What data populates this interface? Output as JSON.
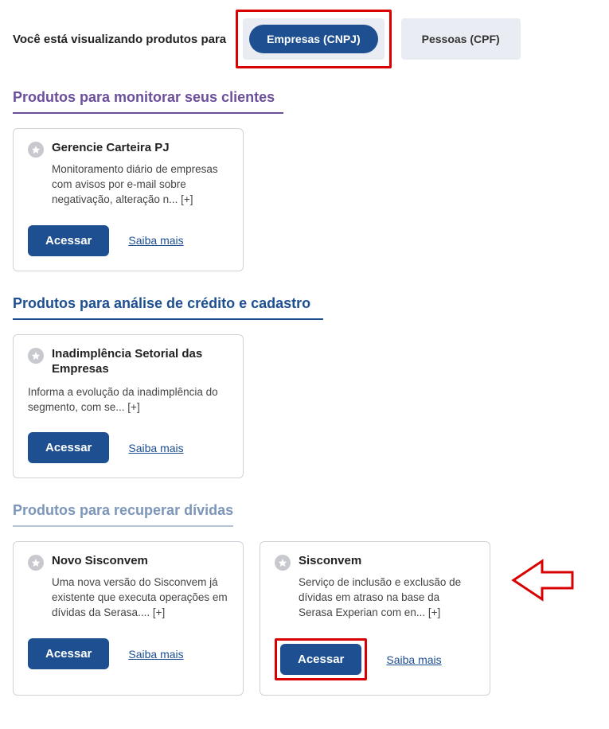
{
  "filter": {
    "label": "Você está visualizando produtos para",
    "option_active": "Empresas (CNPJ)",
    "option_inactive": "Pessoas (CPF)"
  },
  "sections": {
    "monitor": {
      "title": "Produtos para monitorar seus clientes",
      "card": {
        "title": "Gerencie Carteira PJ",
        "desc": "Monitoramento diário de empresas com avisos por e-mail sobre negativação, alteração n... [+]",
        "btn": "Acessar",
        "more": "Saiba mais"
      }
    },
    "credito": {
      "title": "Produtos para análise de crédito e cadastro",
      "card": {
        "title": "Inadimplência Setorial das Empresas",
        "desc": "Informa a evolução da inadimplência do segmento, com se... [+]",
        "btn": "Acessar",
        "more": "Saiba mais"
      }
    },
    "recuperar": {
      "title": "Produtos para recuperar dívidas",
      "card1": {
        "title": "Novo Sisconvem",
        "desc": "Uma nova versão do Sisconvem já existente que executa operações em dívidas da Serasa.... [+]",
        "btn": "Acessar",
        "more": "Saiba mais"
      },
      "card2": {
        "title": "Sisconvem",
        "desc": "Serviço de inclusão e exclusão de dívidas em atraso na base da Serasa Experian com en... [+]",
        "btn": "Acessar",
        "more": "Saiba mais"
      }
    }
  }
}
